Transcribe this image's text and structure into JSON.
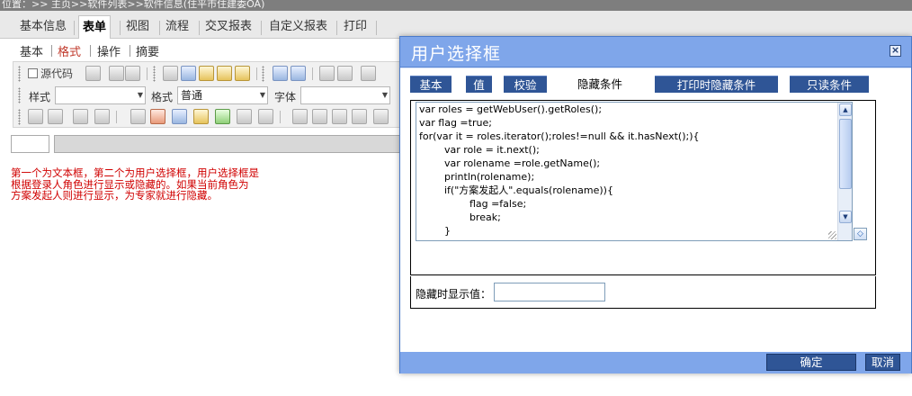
{
  "breadcrumb": "位置：>> 主页>>软件列表>>软件信息(住平市住建委OA)",
  "main_tabs": [
    "基本信息",
    "表单",
    "视图",
    "流程",
    "交叉报表",
    "自定义报表",
    "打印"
  ],
  "sub_tabs": [
    "基本",
    "格式",
    "操作",
    "摘要"
  ],
  "toolbar": {
    "source_label": "源代码",
    "style_label": "样式",
    "format_label": "格式",
    "format_value": "普通",
    "font_label": "字体"
  },
  "note_text": "第一个为文本框，第二个为用户选择框，用户选择框是\n根据登录人角色进行显示或隐藏的。如果当前角色为\n方案发起人则进行显示，为专家就进行隐藏。",
  "dialog": {
    "title": "用户选择框",
    "close_icon": "close-icon",
    "tabs": [
      "基本",
      "值",
      "校验",
      "隐藏条件",
      "打印时隐藏条件",
      "只读条件"
    ],
    "active_tab": "隐藏条件",
    "code_lines": [
      "var roles = getWebUser().getRoles();",
      "var flag =true;",
      "for(var it = roles.iterator();roles!=null && it.hasNext();){",
      "        var role = it.next();",
      "        var rolename =role.getName();",
      "        println(rolename);",
      "        if(\"方案发起人\".equals(rolename)){",
      "                flag =false;",
      "                break;",
      "        }"
    ],
    "hidden_value_label": "隐藏时显示值：",
    "hidden_value": "",
    "ok_label": "确定",
    "cancel_label": "取消"
  },
  "colors": {
    "dialog_header": "#7fa6ea",
    "tab_dark": "#2f5596",
    "note_red": "#d00000"
  }
}
